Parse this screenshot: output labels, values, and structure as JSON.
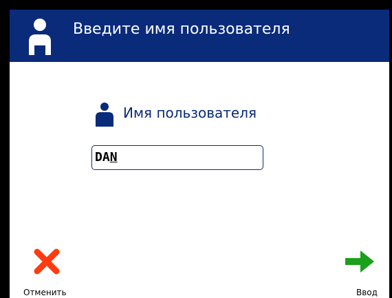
{
  "colors": {
    "header_background": "#0a2b7a",
    "header_text": "#ffffff",
    "label_text": "#0a2b7a",
    "cancel_icon": "#ff3b10",
    "enter_icon": "#1aa01a"
  },
  "header": {
    "title": "Введите имя пользователя",
    "icon": "user-icon"
  },
  "form": {
    "label": "Имя пользователя",
    "label_icon": "user-icon",
    "username_value": "DAN"
  },
  "actions": {
    "cancel_label": "Отменить",
    "cancel_icon": "x-icon",
    "enter_label": "Ввод",
    "enter_icon": "arrow-right-icon"
  }
}
